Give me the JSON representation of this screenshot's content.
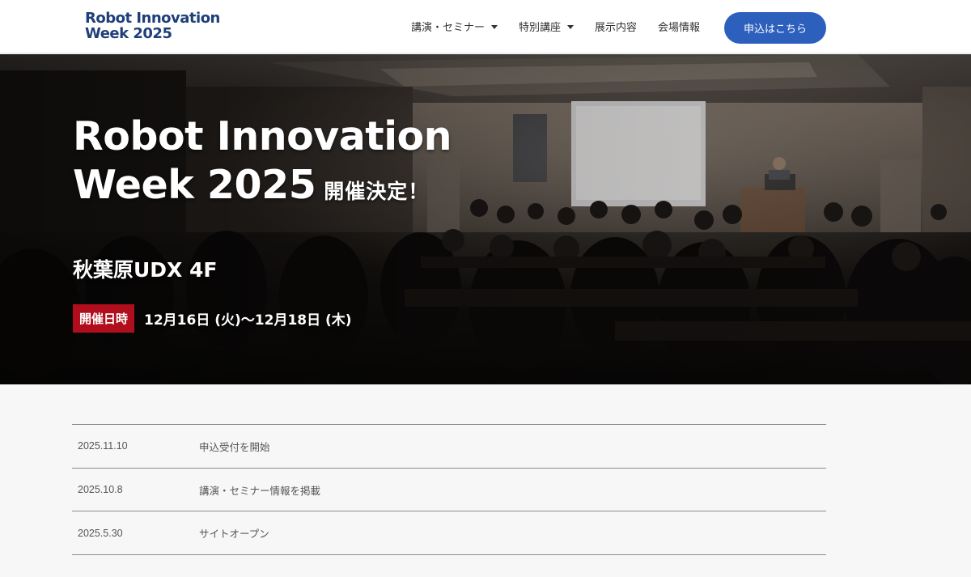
{
  "header": {
    "logo_line1": "Robot Innovation",
    "logo_line2": "Week 2025",
    "nav": [
      {
        "label": "講演・セミナー",
        "dropdown": true
      },
      {
        "label": "特別講座",
        "dropdown": true
      },
      {
        "label": "展示内容",
        "dropdown": false
      },
      {
        "label": "会場情報",
        "dropdown": false
      }
    ],
    "cta_label": "申込はこちら"
  },
  "hero": {
    "title_line1": "Robot Innovation",
    "title_line2": "Week 2025",
    "title_suffix": "開催決定！",
    "venue": "秋葉原UDX 4F",
    "date_badge": "開催日時",
    "date_text": "12月16日 (火)～12月18日 (木)"
  },
  "news": [
    {
      "date": "2025.11.10",
      "title": "申込受付を開始"
    },
    {
      "date": "2025.10.8",
      "title": "講演・セミナー情報を掲載"
    },
    {
      "date": "2025.5.30",
      "title": "サイトオープン"
    }
  ],
  "colors": {
    "brand": "#1f3f7a",
    "cta": "#2d5fbd",
    "badge": "#b00e1d"
  }
}
